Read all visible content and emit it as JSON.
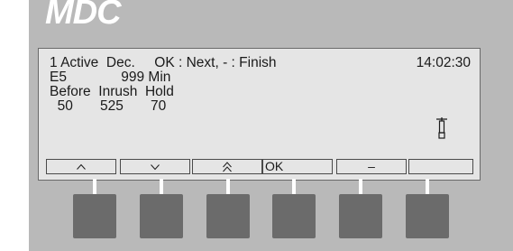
{
  "brand": "MDC",
  "display": {
    "status_line": "1 Active  Dec.     OK : Next, - : Finish",
    "clock": "14:02:30",
    "code_line": "E5              999 Min",
    "headers_line": "Before  Inrush  Hold",
    "values_line": "  50       525       70"
  },
  "softkeys": [
    {
      "label": "",
      "icon": "chevron-up-icon"
    },
    {
      "label": "",
      "icon": "chevron-down-icon"
    },
    {
      "label": "",
      "icon": "double-chevron-up-icon"
    },
    {
      "label": "OK",
      "icon": ""
    },
    {
      "label": "–",
      "icon": ""
    },
    {
      "label": "",
      "icon": ""
    }
  ],
  "indicator_icon": "thermometer-icon",
  "colors": {
    "panel": "#b9b9b9",
    "screen": "#e5e5e5",
    "hardware_key": "#6b6b6b",
    "brand_text": "#ffffff"
  }
}
